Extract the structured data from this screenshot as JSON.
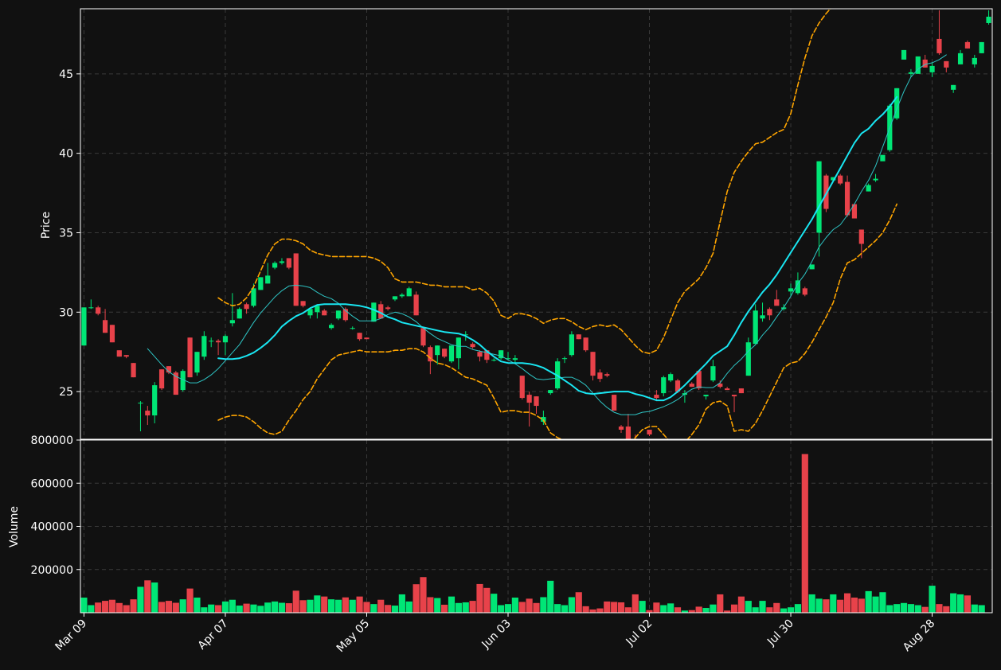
{
  "chart_data": {
    "type": "candlestick",
    "colors": {
      "background": "#111111",
      "up": "#00e676",
      "down": "#e8424a",
      "ma_fast": "#2ec4c4",
      "ma_slow": "#19e6f2",
      "bollinger": "#ffa500",
      "grid": "#3a3a3a",
      "axis": "#ffffff"
    },
    "price_panel": {
      "ylabel": "Price",
      "ylim": [
        22.0,
        49.1
      ],
      "yticks": [
        25,
        30,
        35,
        40,
        45
      ],
      "grid": true
    },
    "volume_panel": {
      "ylabel": "Volume",
      "ylim": [
        0,
        800000
      ],
      "yticks": [
        200000,
        400000,
        600000,
        800000
      ],
      "grid": true
    },
    "x_tick_labels": [
      {
        "label": "Mar 09",
        "index": 0
      },
      {
        "label": "Apr 07",
        "index": 20
      },
      {
        "label": "May 05",
        "index": 40
      },
      {
        "label": "Jun 03",
        "index": 60
      },
      {
        "label": "Jul 02",
        "index": 80
      },
      {
        "label": "Jul 30",
        "index": 100
      },
      {
        "label": "Aug 28",
        "index": 120
      }
    ],
    "ohlc": [
      [
        27.9,
        30.3,
        27.9,
        30.3
      ],
      [
        30.3,
        30.8,
        30.2,
        30.3
      ],
      [
        30.3,
        30.4,
        29.8,
        29.9
      ],
      [
        29.5,
        30.2,
        28.7,
        28.7
      ],
      [
        29.2,
        29.2,
        28.1,
        28.1
      ],
      [
        27.6,
        27.6,
        27.2,
        27.2
      ],
      [
        27.3,
        27.3,
        27.1,
        27.2
      ],
      [
        26.8,
        26.8,
        25.9,
        25.9
      ],
      [
        24.3,
        24.4,
        22.5,
        24.3
      ],
      [
        23.8,
        24.1,
        22.9,
        23.5
      ],
      [
        23.5,
        25.6,
        23.0,
        25.4
      ],
      [
        26.4,
        26.4,
        25.1,
        25.2
      ],
      [
        26.6,
        26.6,
        26.1,
        26.2
      ],
      [
        26.2,
        26.3,
        24.8,
        24.8
      ],
      [
        25.1,
        26.4,
        25.0,
        26.3
      ],
      [
        28.4,
        28.4,
        25.9,
        25.9
      ],
      [
        26.2,
        27.5,
        26.0,
        27.5
      ],
      [
        27.2,
        28.8,
        27.0,
        28.5
      ],
      [
        28.2,
        28.4,
        27.8,
        28.2
      ],
      [
        28.2,
        28.3,
        27.3,
        28.1
      ],
      [
        28.1,
        28.6,
        27.3,
        28.5
      ],
      [
        29.3,
        31.2,
        29.1,
        29.5
      ],
      [
        29.6,
        30.3,
        29.6,
        30.2
      ],
      [
        30.5,
        30.6,
        29.9,
        30.2
      ],
      [
        30.4,
        31.8,
        30.3,
        31.5
      ],
      [
        31.4,
        32.2,
        31.4,
        32.2
      ],
      [
        31.8,
        33.1,
        31.8,
        32.3
      ],
      [
        32.8,
        33.2,
        32.7,
        33.1
      ],
      [
        33.1,
        33.4,
        33.0,
        33.2
      ],
      [
        33.4,
        33.4,
        32.7,
        32.8
      ],
      [
        33.7,
        33.7,
        30.4,
        30.4
      ],
      [
        30.7,
        30.7,
        30.3,
        30.4
      ],
      [
        29.8,
        30.3,
        29.6,
        30.2
      ],
      [
        30.0,
        30.5,
        29.6,
        30.4
      ],
      [
        30.1,
        30.2,
        29.8,
        29.8
      ],
      [
        29.0,
        29.3,
        28.9,
        29.2
      ],
      [
        29.6,
        30.1,
        29.5,
        30.1
      ],
      [
        30.2,
        30.3,
        29.4,
        29.5
      ],
      [
        29.0,
        29.1,
        28.9,
        29.0
      ],
      [
        28.7,
        28.7,
        28.2,
        28.3
      ],
      [
        28.4,
        28.4,
        28.3,
        28.3
      ],
      [
        29.4,
        30.6,
        29.4,
        30.6
      ],
      [
        30.5,
        30.7,
        29.6,
        29.6
      ],
      [
        30.3,
        30.4,
        30.1,
        30.2
      ],
      [
        30.8,
        31.0,
        30.7,
        31.0
      ],
      [
        31.0,
        31.2,
        30.9,
        31.1
      ],
      [
        31.0,
        31.6,
        31.0,
        31.5
      ],
      [
        31.1,
        31.3,
        29.8,
        29.8
      ],
      [
        29.0,
        29.0,
        27.8,
        27.9
      ],
      [
        27.8,
        27.9,
        26.1,
        26.9
      ],
      [
        27.3,
        27.9,
        26.7,
        27.9
      ],
      [
        27.7,
        27.7,
        27.1,
        27.2
      ],
      [
        26.9,
        27.9,
        26.8,
        27.9
      ],
      [
        27.1,
        28.4,
        26.4,
        28.4
      ],
      [
        28.6,
        28.8,
        28.2,
        28.6
      ],
      [
        28.0,
        28.1,
        27.7,
        27.8
      ],
      [
        27.5,
        27.6,
        26.9,
        27.2
      ],
      [
        27.6,
        27.6,
        26.8,
        27.0
      ],
      [
        27.0,
        27.1,
        26.9,
        27.0
      ],
      [
        27.1,
        27.6,
        27.0,
        27.6
      ],
      [
        27.1,
        27.5,
        27.0,
        27.1
      ],
      [
        27.0,
        27.3,
        26.8,
        27.1
      ],
      [
        26.0,
        26.0,
        24.5,
        24.6
      ],
      [
        24.8,
        25.0,
        22.8,
        24.3
      ],
      [
        24.7,
        24.7,
        23.6,
        24.1
      ],
      [
        23.1,
        23.8,
        22.9,
        23.4
      ],
      [
        24.9,
        25.1,
        24.8,
        25.1
      ],
      [
        25.2,
        27.1,
        25.1,
        26.9
      ],
      [
        27.1,
        27.2,
        26.8,
        27.1
      ],
      [
        27.3,
        28.8,
        27.2,
        28.6
      ],
      [
        28.6,
        28.6,
        28.3,
        28.3
      ],
      [
        28.4,
        28.4,
        27.5,
        27.6
      ],
      [
        27.5,
        27.5,
        25.7,
        26.0
      ],
      [
        26.2,
        26.4,
        25.6,
        25.8
      ],
      [
        26.1,
        26.2,
        25.9,
        26.0
      ],
      [
        24.8,
        24.8,
        23.8,
        23.8
      ],
      [
        22.8,
        22.9,
        22.4,
        22.6
      ],
      [
        22.8,
        23.6,
        21.5,
        21.6
      ],
      [
        21.6,
        22.3,
        21.2,
        21.3
      ],
      [
        21.4,
        21.9,
        21.4,
        21.8
      ],
      [
        22.6,
        22.6,
        22.2,
        22.3
      ],
      [
        24.8,
        25.1,
        24.4,
        24.6
      ],
      [
        24.9,
        26.0,
        24.7,
        25.9
      ],
      [
        25.7,
        26.2,
        25.6,
        26.1
      ],
      [
        25.7,
        25.8,
        24.9,
        25.0
      ],
      [
        24.8,
        25.1,
        24.3,
        24.9
      ],
      [
        25.5,
        25.6,
        25.3,
        25.3
      ],
      [
        26.3,
        26.3,
        25.1,
        25.2
      ],
      [
        24.7,
        24.8,
        24.5,
        24.8
      ],
      [
        25.7,
        27.0,
        25.6,
        26.6
      ],
      [
        25.5,
        25.7,
        25.2,
        25.3
      ],
      [
        25.2,
        25.3,
        25.1,
        25.1
      ],
      [
        24.8,
        24.8,
        23.7,
        24.7
      ],
      [
        25.2,
        25.2,
        24.9,
        24.9
      ],
      [
        26.0,
        28.4,
        26.0,
        28.1
      ],
      [
        28.0,
        30.5,
        28.0,
        30.1
      ],
      [
        29.6,
        30.6,
        29.4,
        29.8
      ],
      [
        30.2,
        30.3,
        29.5,
        29.8
      ],
      [
        30.8,
        31.4,
        30.5,
        30.4
      ],
      [
        30.2,
        30.5,
        30.1,
        30.3
      ],
      [
        31.3,
        31.8,
        31.0,
        31.5
      ],
      [
        31.2,
        32.5,
        31.1,
        32.0
      ],
      [
        31.5,
        31.6,
        31.0,
        31.1
      ],
      [
        32.7,
        33.0,
        32.7,
        33.0
      ],
      [
        35.0,
        39.5,
        33.5,
        39.5
      ],
      [
        38.6,
        38.7,
        36.3,
        36.5
      ],
      [
        38.3,
        38.5,
        38.2,
        38.5
      ],
      [
        38.6,
        38.7,
        38.0,
        38.1
      ],
      [
        38.2,
        38.6,
        36.0,
        36.1
      ],
      [
        36.8,
        36.8,
        35.9,
        35.9
      ],
      [
        35.2,
        35.2,
        33.4,
        34.3
      ],
      [
        37.6,
        38.1,
        37.6,
        38.0
      ],
      [
        38.3,
        38.7,
        38.2,
        38.4
      ],
      [
        39.5,
        39.5,
        39.5,
        39.9
      ],
      [
        40.2,
        43.1,
        40.1,
        43.0
      ],
      [
        42.2,
        44.1,
        42.1,
        44.1
      ],
      [
        45.9,
        46.5,
        45.9,
        46.5
      ],
      [
        45.0,
        45.3,
        44.8,
        45.1
      ],
      [
        45.0,
        45.8,
        45.8,
        46.1
      ],
      [
        45.9,
        46.2,
        45.4,
        45.4
      ],
      [
        45.1,
        45.7,
        44.8,
        45.5
      ],
      [
        47.2,
        49.0,
        46.2,
        46.3
      ],
      [
        45.8,
        45.8,
        45.1,
        45.4
      ],
      [
        44.0,
        44.3,
        43.8,
        44.3
      ],
      [
        45.6,
        46.5,
        45.6,
        46.3
      ],
      [
        47.0,
        47.1,
        46.6,
        46.6
      ],
      [
        45.6,
        46.2,
        45.4,
        46.0
      ],
      [
        46.3,
        47.0,
        46.3,
        47.0
      ],
      [
        48.2,
        49.0,
        48.1,
        48.6
      ]
    ],
    "volume": [
      70000,
      35000,
      47000,
      55000,
      60000,
      45000,
      35000,
      62000,
      120000,
      150000,
      140000,
      50000,
      55000,
      46000,
      62000,
      112000,
      70000,
      25000,
      38000,
      35000,
      52000,
      60000,
      33000,
      42000,
      38000,
      32000,
      47000,
      52000,
      46000,
      44000,
      102000,
      58000,
      60000,
      80000,
      75000,
      62000,
      60000,
      71000,
      60000,
      75000,
      50000,
      40000,
      60000,
      36000,
      33000,
      85000,
      52000,
      132000,
      165000,
      72000,
      68000,
      37000,
      75000,
      45000,
      48000,
      55000,
      133000,
      115000,
      88000,
      35000,
      40000,
      70000,
      50000,
      65000,
      45000,
      72000,
      148000,
      40000,
      35000,
      72000,
      95000,
      30000,
      15000,
      20000,
      52000,
      50000,
      48000,
      25000,
      85000,
      55000,
      12000,
      47000,
      35000,
      43000,
      25000,
      10000,
      12000,
      28000,
      22000,
      38000,
      85000,
      10000,
      38000,
      75000,
      55000,
      25000,
      55000,
      25000,
      45000,
      20000,
      25000,
      40000,
      735000,
      85000,
      65000,
      62000,
      85000,
      60000,
      90000,
      70000,
      65000,
      100000,
      75000,
      95000,
      35000,
      40000,
      45000,
      40000,
      35000,
      27000,
      125000,
      40000,
      30000,
      90000,
      85000,
      80000,
      38000,
      35000
    ],
    "ma_fast": {
      "start": 9,
      "values": [
        27.7,
        27.2,
        26.7,
        26.25,
        25.95,
        25.75,
        25.55,
        25.55,
        25.75,
        26.05,
        26.45,
        26.95,
        27.45,
        27.95,
        28.65,
        29.35,
        29.95,
        30.45,
        30.95,
        31.35,
        31.65,
        31.7,
        31.65,
        31.55,
        31.25,
        31.0,
        30.85,
        30.55,
        30.1,
        29.75,
        29.45,
        29.45,
        29.45,
        29.6,
        29.85,
        30.0,
        29.9,
        29.7,
        29.4,
        29.0,
        28.65,
        28.35,
        28.15,
        27.95,
        27.85,
        27.85,
        27.65,
        27.55,
        27.45,
        27.35,
        27.25,
        27.0,
        26.75,
        26.45,
        26.1,
        25.8,
        25.75,
        25.8,
        25.85,
        25.9,
        25.9,
        25.7,
        25.4,
        24.9,
        24.4,
        24.0,
        23.7,
        23.55,
        23.55,
        23.55,
        23.7,
        23.75,
        23.9,
        24.05,
        24.25,
        24.5,
        24.85,
        25.15,
        25.3,
        25.25,
        25.25,
        25.55,
        26.15,
        26.65,
        27.05,
        27.55,
        27.95,
        28.55,
        29.05,
        29.7,
        30.3,
        31.0,
        31.8,
        32.4,
        33.2,
        34.1,
        34.7,
        35.2,
        35.5,
        36.1,
        36.8,
        37.6,
        38.3,
        39.2,
        40.4,
        41.6,
        42.8,
        43.9,
        44.8,
        45.3,
        45.6,
        45.7,
        45.9,
        46.2
      ]
    },
    "ma_slow": {
      "start": 19,
      "values": [
        27.1,
        27.05,
        27.05,
        27.1,
        27.25,
        27.45,
        27.75,
        28.1,
        28.55,
        29.1,
        29.45,
        29.75,
        29.95,
        30.25,
        30.45,
        30.5,
        30.5,
        30.5,
        30.5,
        30.45,
        30.4,
        30.3,
        30.15,
        29.95,
        29.7,
        29.55,
        29.35,
        29.25,
        29.15,
        29.05,
        28.95,
        28.85,
        28.75,
        28.7,
        28.65,
        28.5,
        28.25,
        27.95,
        27.55,
        27.2,
        26.9,
        26.8,
        26.8,
        26.8,
        26.75,
        26.65,
        26.5,
        26.25,
        26.0,
        25.7,
        25.4,
        25.05,
        24.9,
        24.85,
        24.9,
        24.95,
        25.0,
        25.0,
        25.0,
        24.85,
        24.75,
        24.6,
        24.45,
        24.45,
        24.65,
        25.0,
        25.4,
        25.85,
        26.3,
        26.75,
        27.25,
        27.55,
        27.85,
        28.55,
        29.35,
        30.05,
        30.65,
        31.25,
        31.75,
        32.35,
        33.05,
        33.75,
        34.45,
        35.15,
        35.85,
        36.65,
        37.45,
        38.25,
        39.05,
        39.85,
        40.65,
        41.25,
        41.55,
        42.05,
        42.45,
        42.95,
        43.55
      ]
    },
    "bb_upper": {
      "start": 19,
      "values": [
        30.9,
        30.6,
        30.4,
        30.5,
        30.9,
        31.6,
        32.6,
        33.6,
        34.3,
        34.6,
        34.6,
        34.5,
        34.3,
        33.9,
        33.7,
        33.6,
        33.5,
        33.5,
        33.5,
        33.5,
        33.5,
        33.5,
        33.4,
        33.2,
        32.8,
        32.1,
        31.9,
        31.9,
        31.9,
        31.8,
        31.7,
        31.7,
        31.6,
        31.6,
        31.6,
        31.6,
        31.4,
        31.5,
        31.2,
        30.7,
        29.8,
        29.6,
        29.9,
        29.9,
        29.8,
        29.6,
        29.3,
        29.5,
        29.6,
        29.6,
        29.4,
        29.1,
        28.9,
        29.1,
        29.2,
        29.1,
        29.2,
        28.9,
        28.4,
        27.9,
        27.5,
        27.4,
        27.6,
        28.4,
        29.5,
        30.6,
        31.3,
        31.7,
        32.1,
        32.8,
        33.7,
        35.7,
        37.6,
        38.8,
        39.5,
        40.1,
        40.6,
        40.7,
        41.0,
        41.3,
        41.5,
        42.5,
        44.3,
        46.0,
        47.4,
        48.2,
        48.8,
        49.3,
        49.8,
        50.4,
        51.0,
        51.6,
        52.2,
        52.8,
        53.4,
        54.0,
        54.6
      ]
    },
    "bb_lower": {
      "start": 19,
      "values": [
        23.2,
        23.4,
        23.5,
        23.5,
        23.4,
        23.1,
        22.7,
        22.4,
        22.3,
        22.5,
        23.2,
        23.8,
        24.5,
        25.0,
        25.8,
        26.4,
        27.0,
        27.3,
        27.4,
        27.5,
        27.6,
        27.5,
        27.5,
        27.5,
        27.5,
        27.6,
        27.6,
        27.7,
        27.7,
        27.5,
        27.1,
        26.8,
        26.7,
        26.5,
        26.2,
        25.9,
        25.8,
        25.6,
        25.4,
        24.6,
        23.7,
        23.8,
        23.8,
        23.7,
        23.7,
        23.5,
        23.2,
        22.4,
        22.1,
        21.9,
        21.4,
        21.0,
        20.8,
        20.8,
        20.9,
        21.0,
        21.0,
        21.2,
        21.6,
        22.1,
        22.6,
        22.8,
        22.8,
        22.3,
        21.8,
        21.8,
        21.8,
        22.3,
        22.9,
        23.9,
        24.3,
        24.4,
        24.1,
        22.5,
        22.6,
        22.5,
        23.0,
        23.8,
        24.7,
        25.6,
        26.5,
        26.8,
        26.9,
        27.4,
        28.1,
        28.9,
        29.7,
        30.6,
        32.1,
        33.1,
        33.3,
        33.7,
        34.1,
        34.5,
        35.0,
        35.8,
        36.8
      ]
    }
  }
}
